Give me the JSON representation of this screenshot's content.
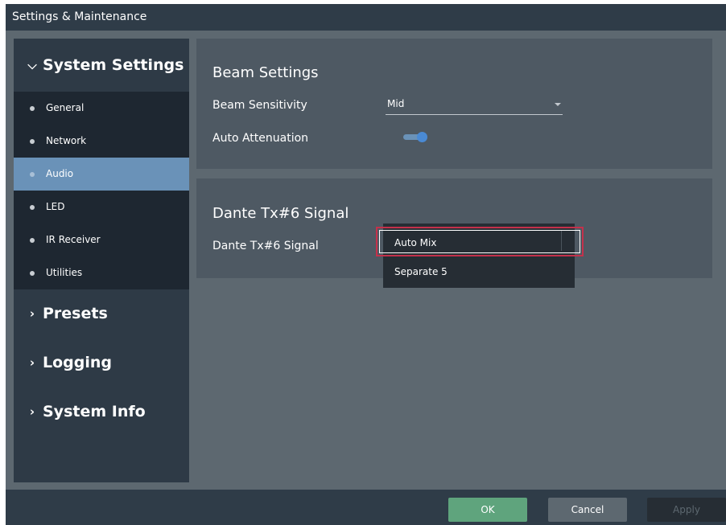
{
  "window": {
    "title": "Settings & Maintenance"
  },
  "sidebar": {
    "sections": [
      {
        "label": "System Settings",
        "expanded": true
      },
      {
        "label": "Presets",
        "expanded": false
      },
      {
        "label": "Logging",
        "expanded": false
      },
      {
        "label": "System Info",
        "expanded": false
      }
    ],
    "items": [
      {
        "label": "General",
        "active": false
      },
      {
        "label": "Network",
        "active": false
      },
      {
        "label": "Audio",
        "active": true
      },
      {
        "label": "LED",
        "active": false
      },
      {
        "label": "IR Receiver",
        "active": false
      },
      {
        "label": "Utilities",
        "active": false
      }
    ]
  },
  "beam": {
    "title": "Beam Settings",
    "sensitivity_label": "Beam Sensitivity",
    "sensitivity_value": "Mid",
    "attenuation_label": "Auto Attenuation",
    "attenuation_on": true
  },
  "dante": {
    "title": "Dante Tx#6 Signal",
    "signal_label": "Dante Tx#6 Signal",
    "options": [
      "Auto Mix",
      "Separate 5"
    ],
    "selected": "Auto Mix"
  },
  "footer": {
    "ok": "OK",
    "cancel": "Cancel",
    "apply": "Apply"
  },
  "icons": {
    "expanded": "chevron-down-icon",
    "collapsed": "chevron-right-icon",
    "bullet": "bullet-dot-icon",
    "select_arrow": "caret-down-icon"
  },
  "colors": {
    "accent": "#6a92b8",
    "toggle_on": "#4a8ad4",
    "ok_button": "#5fa47d",
    "highlight": "#c4314b"
  }
}
